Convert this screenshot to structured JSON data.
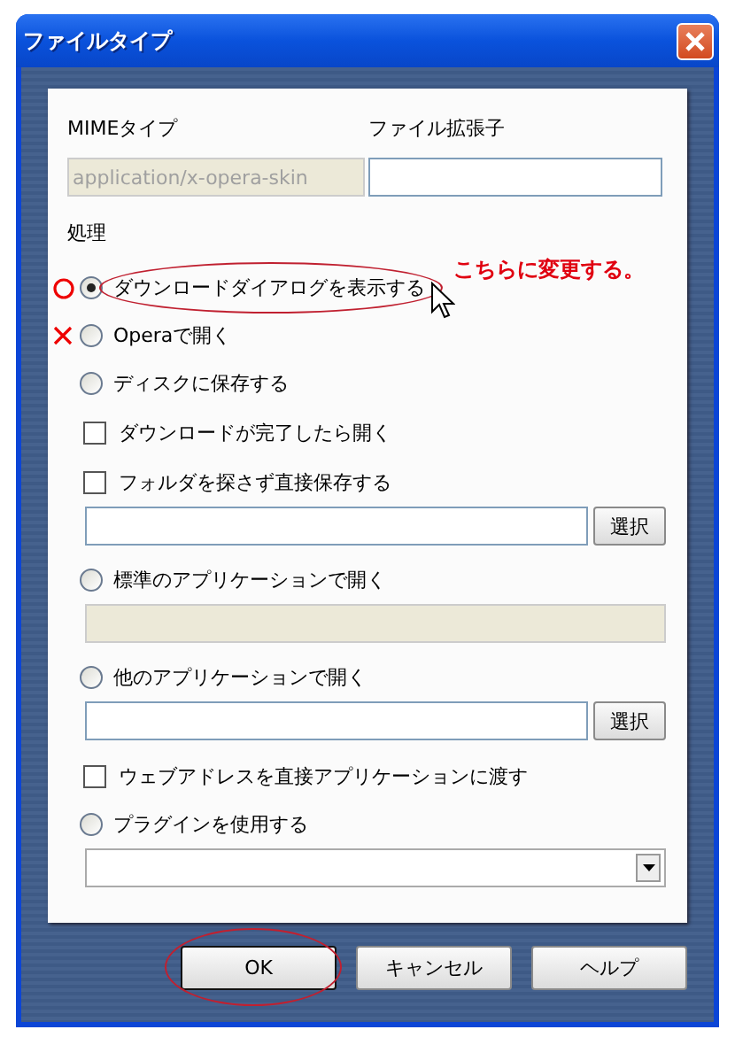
{
  "window": {
    "title": "ファイルタイプ"
  },
  "mime": {
    "label": "MIMEタイプ",
    "value": "application/x-opera-skin",
    "disabled": true
  },
  "extension": {
    "label": "ファイル拡張子"
  },
  "section_label": "処理",
  "items": [
    {
      "kind": "radio",
      "label": "ダウンロードダイアログを表示する",
      "selected": true,
      "circle_mark": true,
      "cross_mark": false,
      "circled": true,
      "note": "こちらに変更する。"
    },
    {
      "kind": "radio",
      "label": "Operaで開く",
      "selected": false,
      "circle_mark": false,
      "cross_mark": true,
      "circled": false
    },
    {
      "kind": "radio",
      "label": "ディスクに保存する",
      "selected": false
    },
    {
      "kind": "checkbox",
      "label": "ダウンロードが完了したら開く",
      "checked": false
    },
    {
      "kind": "checkbox",
      "label": "フォルダを探さず直接保存する",
      "checked": false
    },
    {
      "kind": "path",
      "button": "選択",
      "disabled": false
    },
    {
      "kind": "radio",
      "label": "標準のアプリケーションで開く",
      "selected": false
    },
    {
      "kind": "path",
      "disabled": true
    },
    {
      "kind": "radio",
      "label": "他のアプリケーションで開く",
      "selected": false
    },
    {
      "kind": "path",
      "button": "選択",
      "disabled": false
    },
    {
      "kind": "checkbox",
      "label": "ウェブアドレスを直接アプリケーションに渡す",
      "checked": false
    },
    {
      "kind": "radio",
      "label": "プラグインを使用する",
      "selected": false
    },
    {
      "kind": "dropdown"
    }
  ],
  "buttons": [
    {
      "label": "OK",
      "circled": true
    },
    {
      "label": "キャンセル",
      "circled": false
    },
    {
      "label": "ヘルプ",
      "circled": false
    }
  ]
}
